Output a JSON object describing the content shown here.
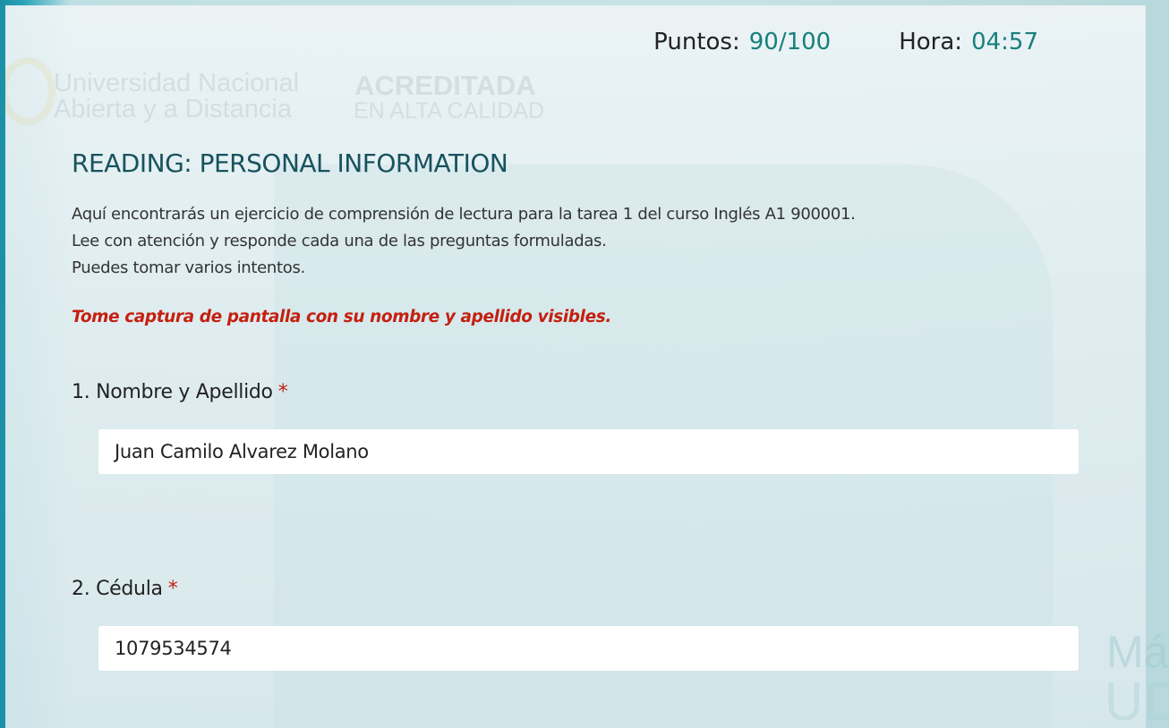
{
  "header": {
    "points_label": "Puntos:",
    "points_value": "90/100",
    "time_label": "Hora:",
    "time_value": "04:57"
  },
  "watermark": {
    "university_line1": "Universidad Nacional",
    "university_line2": "Abierta y a Distancia",
    "accredited_line1": "ACREDITADA",
    "accredited_line2": "EN ALTA CALIDAD",
    "corner_top": "Má",
    "corner_bottom": "UD"
  },
  "form": {
    "title": "READING: PERSONAL INFORMATION",
    "description": [
      "Aquí encontrarás un ejercicio de comprensión de lectura para la tarea 1 del curso Inglés A1 900001.",
      "Lee con atención y responde cada una de las preguntas formuladas.",
      "Puedes tomar varios intentos."
    ],
    "warning": "Tome captura de pantalla con su nombre y apellido visibles.",
    "questions": [
      {
        "number": "1.",
        "label": "Nombre y Apellido",
        "required_mark": "*",
        "answer": "Juan Camilo Alvarez Molano"
      },
      {
        "number": "2.",
        "label": "Cédula",
        "required_mark": "*",
        "answer": "1079534574"
      }
    ]
  },
  "colors": {
    "accent_teal": "#16807f",
    "title_color": "#17525e",
    "required_red": "#c42010"
  }
}
